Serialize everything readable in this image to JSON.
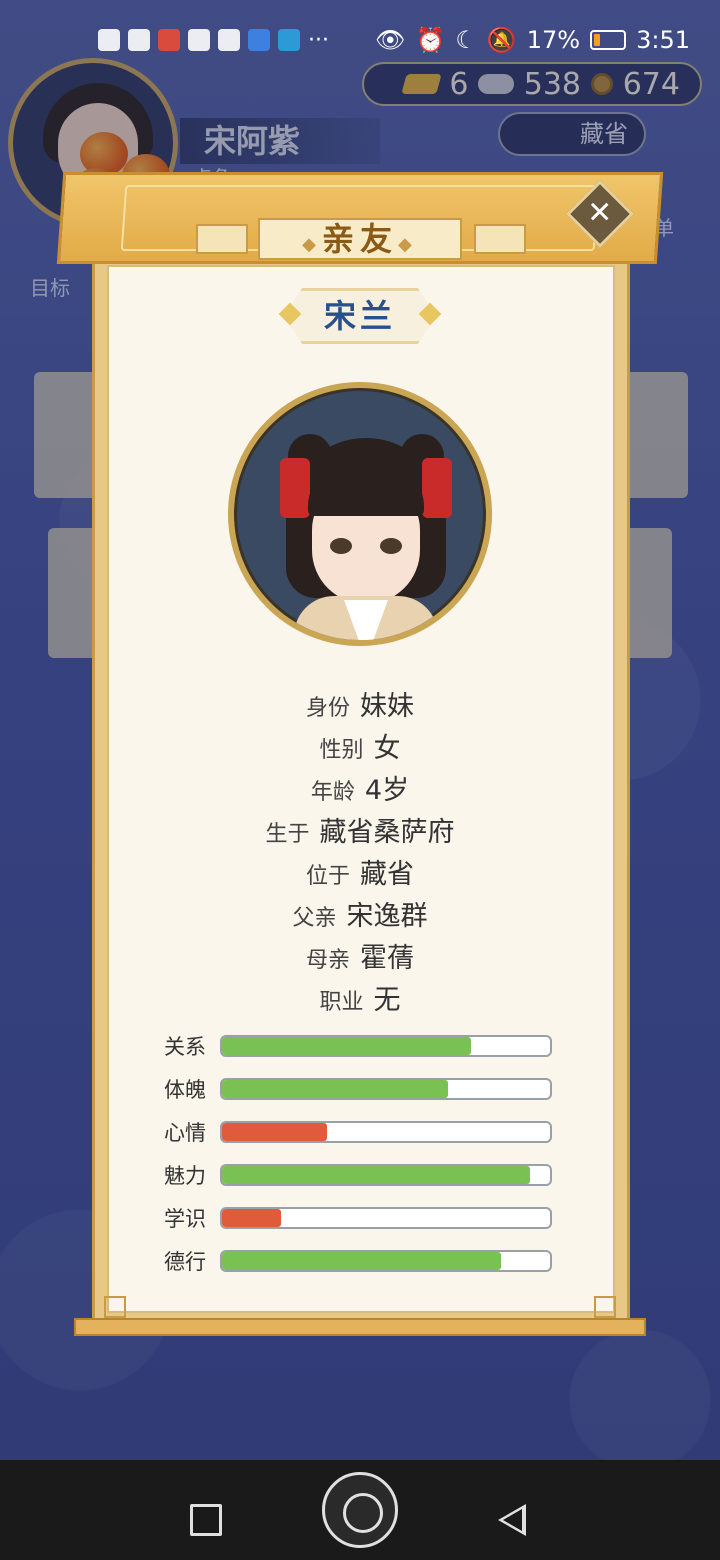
{
  "status_bar": {
    "battery_percent": "17%",
    "battery_level": 0.17,
    "time": "3:51",
    "more": "···"
  },
  "hud": {
    "player_name": "宋阿紫",
    "player_sub": "点角",
    "gold": "6",
    "silver": "538",
    "coins": "674",
    "province": "藏省",
    "goal_label": "目标",
    "menu_label": "菜单"
  },
  "modal": {
    "title": "亲友",
    "name": "宋兰",
    "info": [
      {
        "label": "身份",
        "value": "妹妹"
      },
      {
        "label": "性别",
        "value": "女"
      },
      {
        "label": "年龄",
        "value": "4岁"
      },
      {
        "label": "生于",
        "value": "藏省桑萨府"
      },
      {
        "label": "位于",
        "value": "藏省"
      },
      {
        "label": "父亲",
        "value": "宋逸群"
      },
      {
        "label": "母亲",
        "value": "霍蒨"
      },
      {
        "label": "职业",
        "value": "无"
      }
    ],
    "stats": [
      {
        "label": "关系",
        "level": 0.76,
        "color": "green"
      },
      {
        "label": "体魄",
        "level": 0.69,
        "color": "green"
      },
      {
        "label": "心情",
        "level": 0.32,
        "color": "red"
      },
      {
        "label": "魅力",
        "level": 0.94,
        "color": "green"
      },
      {
        "label": "学识",
        "level": 0.18,
        "color": "red"
      },
      {
        "label": "德行",
        "level": 0.85,
        "color": "green"
      }
    ],
    "close_symbol": "✕"
  },
  "colors": {
    "bar_green": "#7ac153",
    "bar_red": "#e05a3c",
    "name_blue": "#27508f",
    "title_brown": "#8a5a16"
  }
}
